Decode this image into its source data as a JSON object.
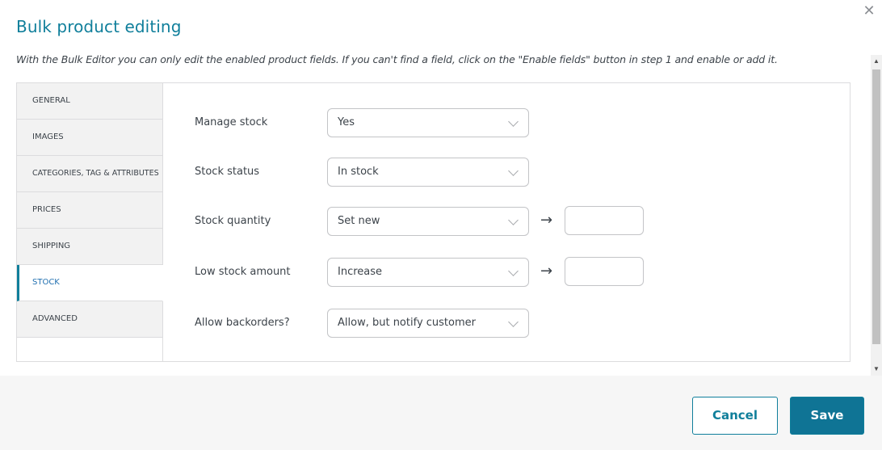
{
  "modal": {
    "title": "Bulk product editing",
    "close_icon": "close-icon",
    "description": "With the Bulk Editor you can only edit the enabled product fields. If you can't find a field, click on the \"Enable fields\" button in step 1 and enable or add it."
  },
  "tabs": [
    {
      "label": "GENERAL"
    },
    {
      "label": "IMAGES"
    },
    {
      "label": "CATEGORIES, TAG & ATTRIBUTES"
    },
    {
      "label": "PRICES"
    },
    {
      "label": "SHIPPING"
    },
    {
      "label": "STOCK",
      "active": true
    },
    {
      "label": "ADVANCED"
    }
  ],
  "fields": {
    "manage_stock": {
      "label": "Manage stock",
      "value": "Yes"
    },
    "stock_status": {
      "label": "Stock status",
      "value": "In stock"
    },
    "stock_quantity": {
      "label": "Stock quantity",
      "value": "Set new",
      "arrow": "→",
      "input_value": ""
    },
    "low_stock_amount": {
      "label": "Low stock amount",
      "value": "Increase",
      "arrow": "→",
      "input_value": ""
    },
    "allow_backorders": {
      "label": "Allow backorders?",
      "value": "Allow, but notify customer"
    }
  },
  "footer": {
    "cancel_label": "Cancel",
    "save_label": "Save"
  },
  "colors": {
    "accent": "#107f9b",
    "save_bg": "#0f7495",
    "footer_bg": "#f6f6f6",
    "tab_bg": "#f2f2f2"
  }
}
